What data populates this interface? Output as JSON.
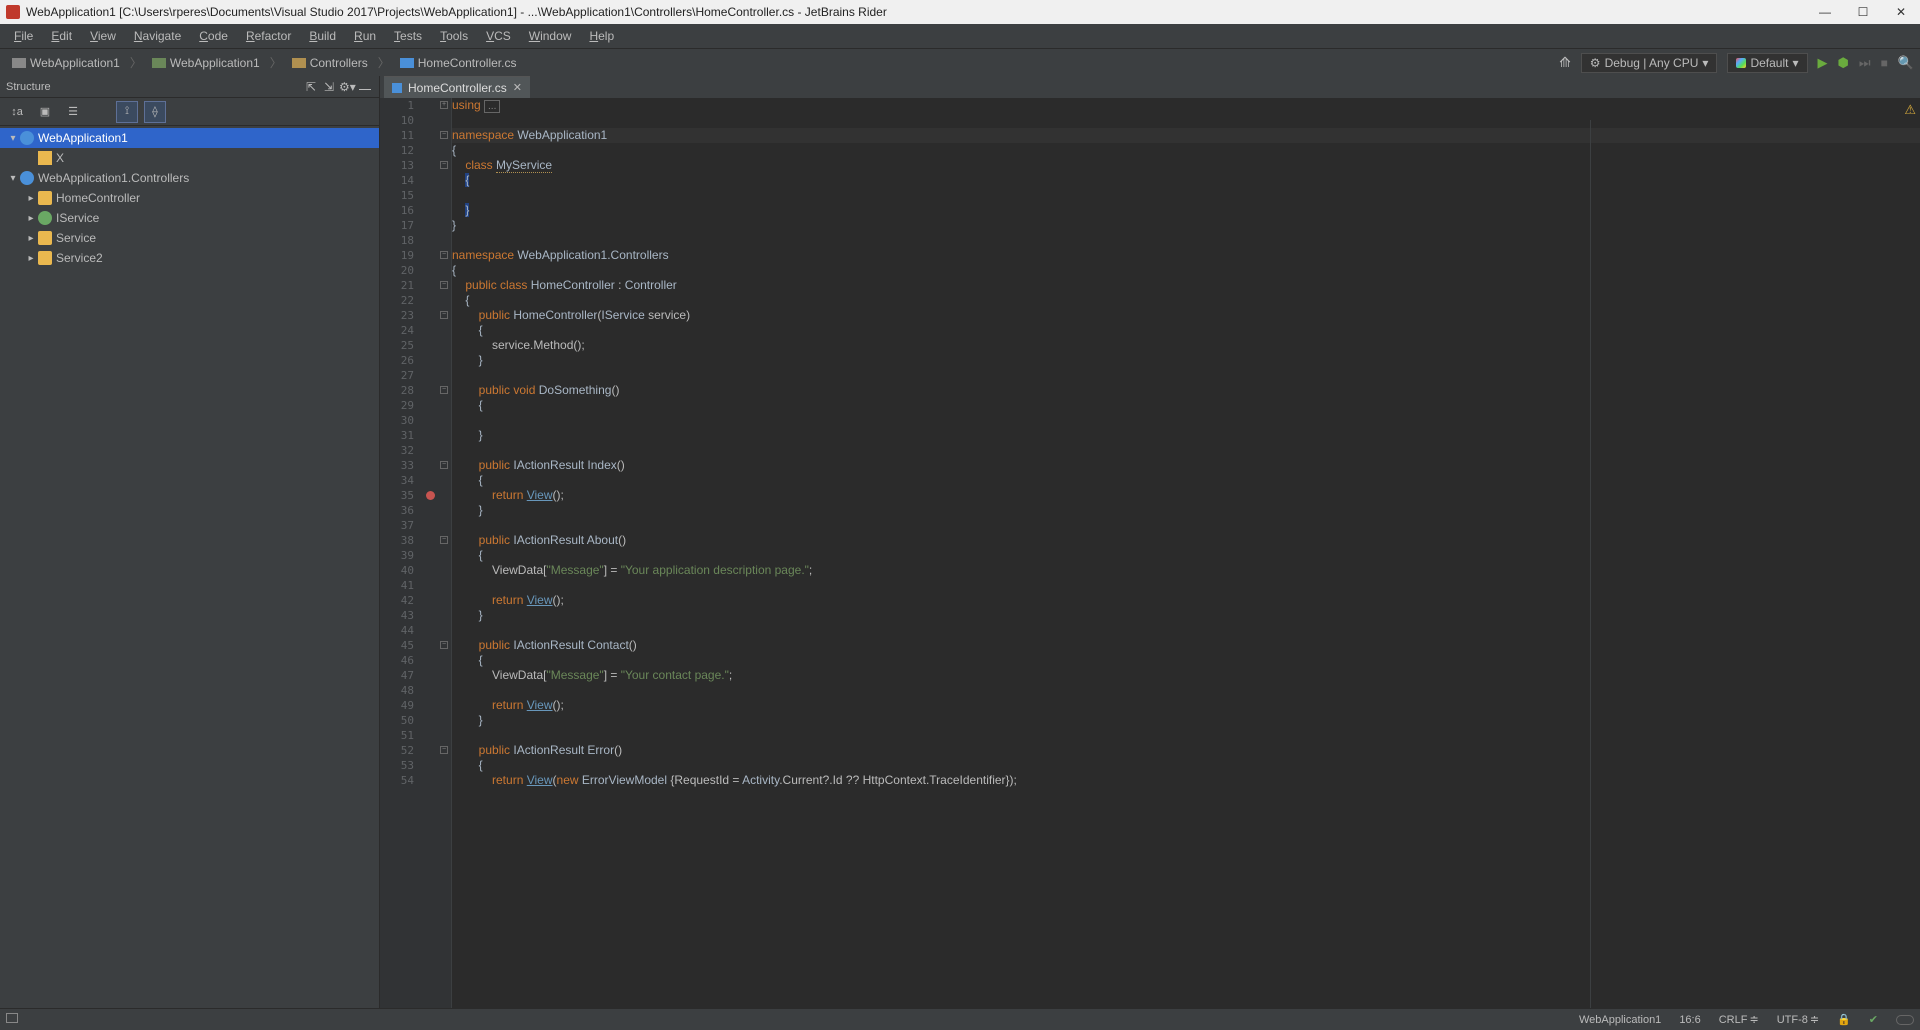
{
  "title": "WebApplication1 [C:\\Users\\rperes\\Documents\\Visual Studio 2017\\Projects\\WebApplication1] - ...\\WebApplication1\\Controllers\\HomeController.cs - JetBrains Rider",
  "menu": [
    "File",
    "Edit",
    "View",
    "Navigate",
    "Code",
    "Refactor",
    "Build",
    "Run",
    "Tests",
    "Tools",
    "VCS",
    "Window",
    "Help"
  ],
  "breadcrumbs": [
    {
      "label": "WebApplication1",
      "icon": "sln"
    },
    {
      "label": "WebApplication1",
      "icon": "prj"
    },
    {
      "label": "Controllers",
      "icon": "fld"
    },
    {
      "label": "HomeController.cs",
      "icon": "cs"
    }
  ],
  "run_config": "Debug | Any CPU",
  "target": "Default",
  "structure": {
    "title": "Structure",
    "tree": [
      {
        "depth": 0,
        "arrow": "down",
        "icon": "ns",
        "label": "WebApplication1",
        "selected": true
      },
      {
        "depth": 1,
        "arrow": "",
        "icon": "svcx",
        "label": "X"
      },
      {
        "depth": 0,
        "arrow": "down",
        "icon": "ns",
        "label": "WebApplication1.Controllers"
      },
      {
        "depth": 1,
        "arrow": "right",
        "icon": "cls",
        "label": "HomeController"
      },
      {
        "depth": 1,
        "arrow": "right",
        "icon": "int",
        "label": "IService"
      },
      {
        "depth": 1,
        "arrow": "right",
        "icon": "cls",
        "label": "Service"
      },
      {
        "depth": 1,
        "arrow": "right",
        "icon": "cls",
        "label": "Service2"
      }
    ]
  },
  "tab": {
    "label": "HomeController.cs"
  },
  "gutter_start": 1,
  "breakpoint_line": 35,
  "code": [
    {
      "n": 1,
      "fm": "+",
      "html": "<span class='kw'>using</span> <span class='fold-box'>...</span>"
    },
    {
      "n": 10,
      "html": ""
    },
    {
      "n": 11,
      "hl": true,
      "fm": "-",
      "html": "<span class='kw'>namespace</span> <span class='typname'>WebApplication1</span>"
    },
    {
      "n": 12,
      "html": "<span class='brace'>{</span>"
    },
    {
      "n": 13,
      "fm": "-",
      "html": "    <span class='kw'>class</span> <span class='typname underline'>MyService</span>"
    },
    {
      "n": 14,
      "html": "    <span class='brace' style='background:#214283;'>{</span>"
    },
    {
      "n": 15,
      "html": ""
    },
    {
      "n": 16,
      "html": "    <span class='brace' style='background:#214283;'>}</span>"
    },
    {
      "n": 17,
      "html": "<span class='brace'>}</span>"
    },
    {
      "n": 18,
      "html": ""
    },
    {
      "n": 19,
      "fm": "-",
      "html": "<span class='kw'>namespace</span> <span class='typname'>WebApplication1.Controllers</span>"
    },
    {
      "n": 20,
      "html": "<span class='brace'>{</span>"
    },
    {
      "n": 21,
      "fm": "-",
      "html": "    <span class='kw'>public</span> <span class='kw'>class</span> <span class='typname'>HomeController</span> : <span class='typname'>Controller</span>"
    },
    {
      "n": 22,
      "html": "    <span class='brace'>{</span>"
    },
    {
      "n": 23,
      "fm": "-",
      "html": "        <span class='kw'>public</span> <span class='id'>HomeController</span>(<span class='typname'>IService</span> service)"
    },
    {
      "n": 24,
      "html": "        <span class='brace'>{</span>"
    },
    {
      "n": 25,
      "html": "            service.Method();"
    },
    {
      "n": 26,
      "html": "        <span class='brace'>}</span>"
    },
    {
      "n": 27,
      "html": ""
    },
    {
      "n": 28,
      "fm": "-",
      "html": "        <span class='kw'>public</span> <span class='kw'>void</span> <span class='id'>DoSomething</span>()"
    },
    {
      "n": 29,
      "html": "        <span class='brace'>{</span>"
    },
    {
      "n": 30,
      "html": ""
    },
    {
      "n": 31,
      "html": "        <span class='brace'>}</span>"
    },
    {
      "n": 32,
      "html": ""
    },
    {
      "n": 33,
      "fm": "-",
      "html": "        <span class='kw'>public</span> <span class='typname'>IActionResult</span> <span class='id'>Index</span>()"
    },
    {
      "n": 34,
      "html": "        <span class='brace'>{</span>"
    },
    {
      "n": 35,
      "html": "            <span class='kw'>return</span> <span class='lnk'>View</span>();"
    },
    {
      "n": 36,
      "html": "        <span class='brace'>}</span>"
    },
    {
      "n": 37,
      "html": ""
    },
    {
      "n": 38,
      "fm": "-",
      "html": "        <span class='kw'>public</span> <span class='typname'>IActionResult</span> <span class='id'>About</span>()"
    },
    {
      "n": 39,
      "html": "        <span class='brace'>{</span>"
    },
    {
      "n": 40,
      "html": "            ViewData[<span class='str'>\"Message\"</span>] = <span class='str'>\"Your application description page.\"</span>;"
    },
    {
      "n": 41,
      "html": ""
    },
    {
      "n": 42,
      "html": "            <span class='kw'>return</span> <span class='lnk'>View</span>();"
    },
    {
      "n": 43,
      "html": "        <span class='brace'>}</span>"
    },
    {
      "n": 44,
      "html": ""
    },
    {
      "n": 45,
      "fm": "-",
      "html": "        <span class='kw'>public</span> <span class='typname'>IActionResult</span> <span class='id'>Contact</span>()"
    },
    {
      "n": 46,
      "html": "        <span class='brace'>{</span>"
    },
    {
      "n": 47,
      "html": "            ViewData[<span class='str'>\"Message\"</span>] = <span class='str'>\"Your contact page.\"</span>;"
    },
    {
      "n": 48,
      "html": ""
    },
    {
      "n": 49,
      "html": "            <span class='kw'>return</span> <span class='lnk'>View</span>();"
    },
    {
      "n": 50,
      "html": "        <span class='brace'>}</span>"
    },
    {
      "n": 51,
      "html": ""
    },
    {
      "n": 52,
      "fm": "-",
      "html": "        <span class='kw'>public</span> <span class='typname'>IActionResult</span> <span class='id'>Error</span>()"
    },
    {
      "n": 53,
      "html": "        <span class='brace'>{</span>"
    },
    {
      "n": 54,
      "html": "            <span class='kw'>return</span> <span class='lnk'>View</span>(<span class='kw'>new</span> <span class='typname'>ErrorViewModel</span> {RequestId = <span class='typname'>Activity</span>.Current?.Id ?? HttpContext.TraceIdentifier});"
    }
  ],
  "status": {
    "project": "WebApplication1",
    "caret": "16:6",
    "line_sep": "CRLF",
    "encoding": "UTF-8"
  }
}
